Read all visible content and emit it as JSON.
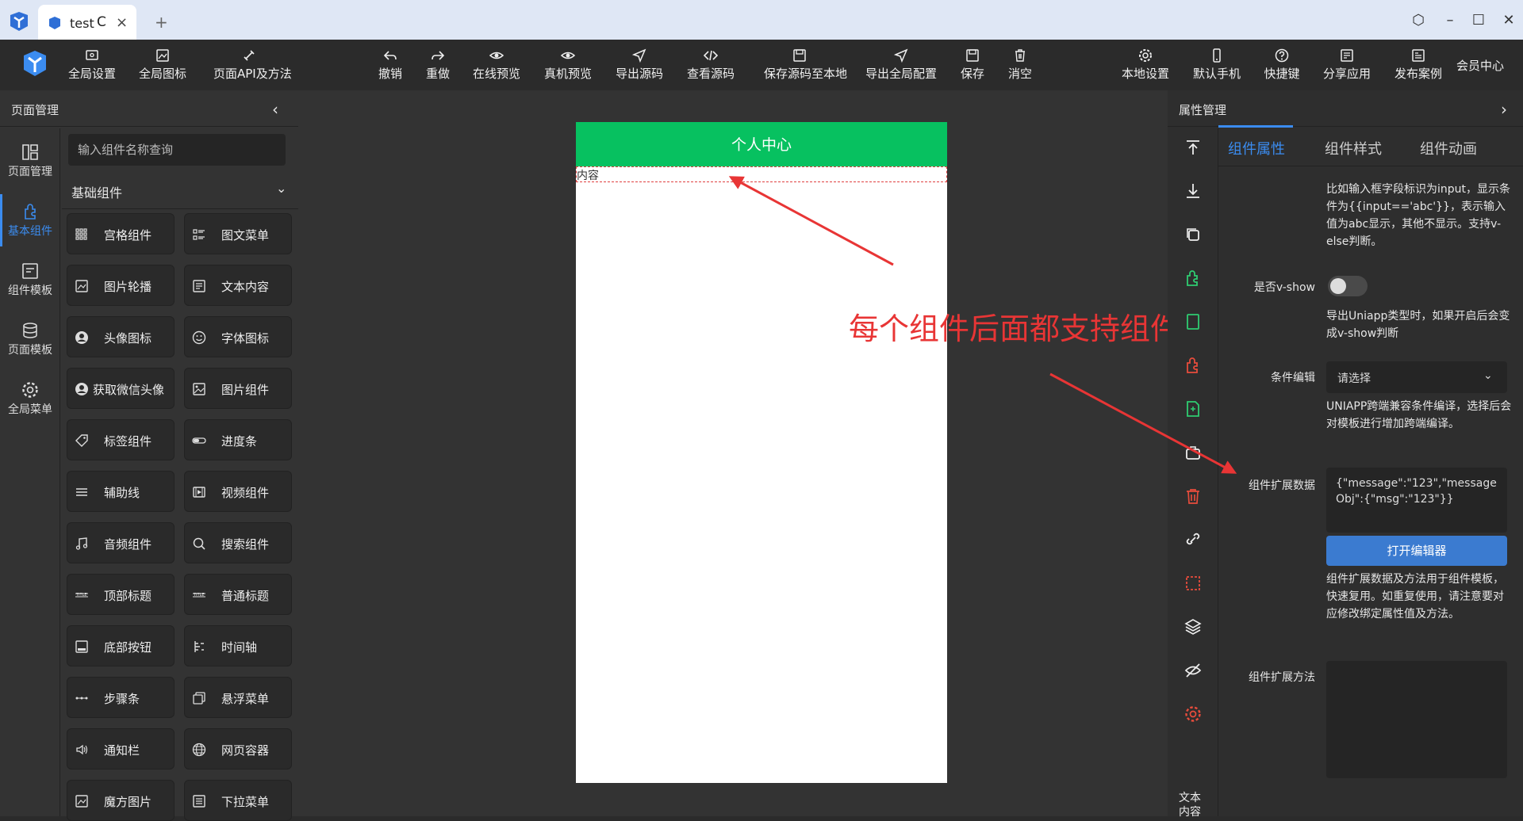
{
  "browser": {
    "tab_title": "test",
    "reload_glyph": "C",
    "close_glyph": "×",
    "new_tab_glyph": "+"
  },
  "toolbar": {
    "left": [
      {
        "label": "全局设置",
        "icon": "settings-screen-icon"
      },
      {
        "label": "全局图标",
        "icon": "image-icon"
      },
      {
        "label": "页面API及方法",
        "icon": "api-icon"
      }
    ],
    "middle": [
      {
        "label": "撤销",
        "icon": "undo-icon"
      },
      {
        "label": "重做",
        "icon": "redo-icon"
      },
      {
        "label": "在线预览",
        "icon": "eye-icon"
      },
      {
        "label": "真机预览",
        "icon": "eye-icon"
      },
      {
        "label": "导出源码",
        "icon": "send-icon"
      },
      {
        "label": "查看源码",
        "icon": "code-icon"
      },
      {
        "label": "保存源码至本地",
        "icon": "save-icon"
      },
      {
        "label": "导出全局配置",
        "icon": "send-icon"
      },
      {
        "label": "保存",
        "icon": "save-icon"
      },
      {
        "label": "消空",
        "icon": "trash-icon"
      }
    ],
    "right": [
      {
        "label": "本地设置",
        "icon": "gear-icon"
      },
      {
        "label": "默认手机",
        "icon": "phone-icon"
      },
      {
        "label": "快捷键",
        "icon": "help-icon"
      },
      {
        "label": "分享应用",
        "icon": "share-icon"
      },
      {
        "label": "发布案例",
        "icon": "publish-icon"
      }
    ],
    "member": "会员中心"
  },
  "left_panel": {
    "title": "页面管理",
    "nav": [
      {
        "label": "页面管理",
        "active": false
      },
      {
        "label": "基本组件",
        "active": true
      },
      {
        "label": "组件模板",
        "active": false
      },
      {
        "label": "页面模板",
        "active": false
      },
      {
        "label": "全局菜单",
        "active": false
      }
    ],
    "search_placeholder": "输入组件名称查询",
    "category": "基础组件",
    "components": [
      {
        "label": "宫格组件",
        "icon": "grid-icon"
      },
      {
        "label": "图文菜单",
        "icon": "list-icon"
      },
      {
        "label": "图片轮播",
        "icon": "carousel-icon"
      },
      {
        "label": "文本内容",
        "icon": "text-icon"
      },
      {
        "label": "头像图标",
        "icon": "avatar-icon"
      },
      {
        "label": "字体图标",
        "icon": "smile-icon"
      },
      {
        "label": "获取微信头像",
        "icon": "avatar-icon"
      },
      {
        "label": "图片组件",
        "icon": "picture-icon"
      },
      {
        "label": "标签组件",
        "icon": "tag-icon"
      },
      {
        "label": "进度条",
        "icon": "progress-icon"
      },
      {
        "label": "辅助线",
        "icon": "lines-icon"
      },
      {
        "label": "视频组件",
        "icon": "video-icon"
      },
      {
        "label": "音频组件",
        "icon": "music-icon"
      },
      {
        "label": "搜索组件",
        "icon": "search-icon"
      },
      {
        "label": "顶部标题",
        "icon": "title-icon"
      },
      {
        "label": "普通标题",
        "icon": "title-icon"
      },
      {
        "label": "底部按钮",
        "icon": "bottom-button-icon"
      },
      {
        "label": "时间轴",
        "icon": "timeline-icon"
      },
      {
        "label": "步骤条",
        "icon": "steps-icon"
      },
      {
        "label": "悬浮菜单",
        "icon": "float-menu-icon"
      },
      {
        "label": "通知栏",
        "icon": "speaker-icon"
      },
      {
        "label": "网页容器",
        "icon": "globe-icon"
      },
      {
        "label": "魔方图片",
        "icon": "cube-image-icon"
      },
      {
        "label": "下拉菜单",
        "icon": "dropdown-menu-icon"
      }
    ]
  },
  "canvas": {
    "phone_title": "个人中心",
    "phone_content": "内容",
    "annotation": "每个组件后面都支持组件扩展数据",
    "theme_color": "#07c160",
    "annotation_color": "#e83535"
  },
  "right_panel": {
    "title": "属性管理",
    "tabs": [
      "组件属性",
      "组件样式",
      "组件动画"
    ],
    "tool_text": "文本\n内容",
    "help_vif": "比如输入框字段标识为input，显示条件为{{input=='abc'}}，表示输入值为abc显示，其他不显示。支持v-else判断。",
    "vshow_label": "是否v-show",
    "vshow_help": "导出Uniapp类型时，如果开启后会变成v-show判断",
    "cond_label": "条件编辑",
    "cond_placeholder": "请选择",
    "cond_help": "UNIAPP跨端兼容条件编译，选择后会对模板进行增加跨端编译。",
    "ext_data_label": "组件扩展数据",
    "ext_data_value": "{\"message\":\"123\",\"messageObj\":{\"msg\":\"123\"}}",
    "open_editor": "打开编辑器",
    "ext_data_help": "组件扩展数据及方法用于组件模板，快速复用。如重复使用，请注意要对应修改绑定属性值及方法。",
    "ext_method_label": "组件扩展方法",
    "ext_method_value": ""
  }
}
